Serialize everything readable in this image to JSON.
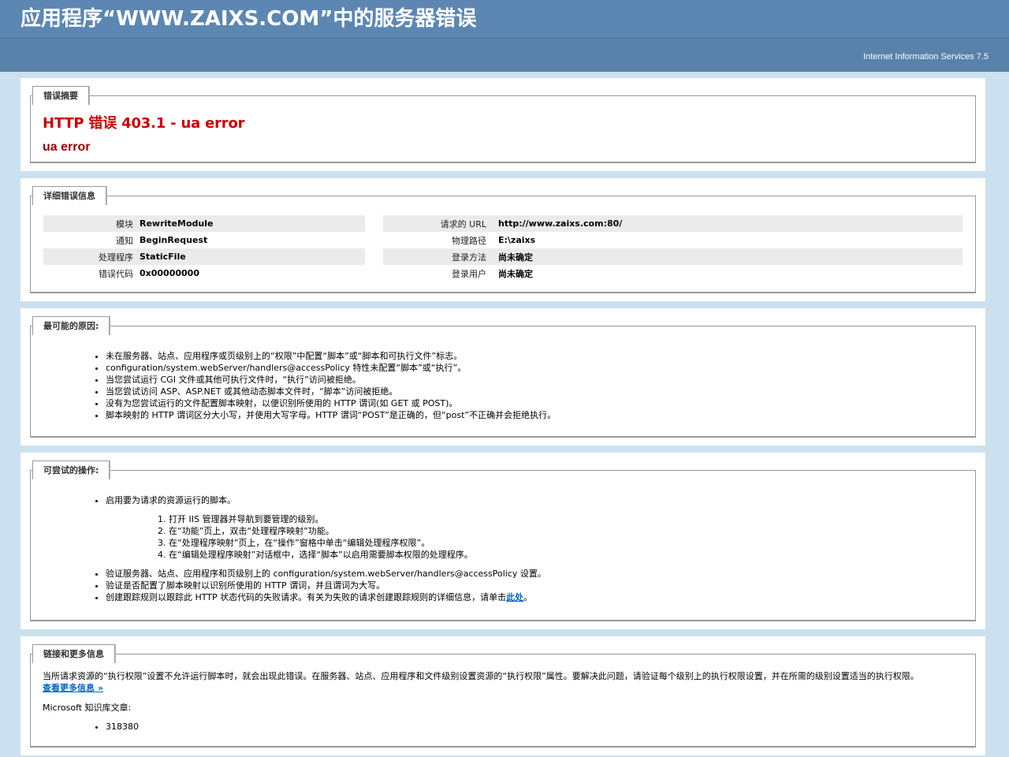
{
  "header": {
    "title": "应用程序“WWW.ZAIXS.COM”中的服务器错误",
    "server": "Internet Information Services 7.5"
  },
  "summary": {
    "legend": "错误摘要",
    "heading": "HTTP 错误 403.1 - ua error",
    "subheading": "ua error"
  },
  "details": {
    "legend": "详细错误信息",
    "left": [
      {
        "label": "模块",
        "value": "RewriteModule"
      },
      {
        "label": "通知",
        "value": "BeginRequest"
      },
      {
        "label": "处理程序",
        "value": "StaticFile"
      },
      {
        "label": "错误代码",
        "value": "0x00000000"
      }
    ],
    "right": [
      {
        "label": "请求的 URL",
        "value": "http://www.zaixs.com:80/"
      },
      {
        "label": "物理路径",
        "value": "E:\\zaixs"
      },
      {
        "label": "登录方法",
        "value": "尚未确定"
      },
      {
        "label": "登录用户",
        "value": "尚未确定"
      }
    ]
  },
  "causes": {
    "legend": "最可能的原因:",
    "items": [
      "未在服务器、站点、应用程序或页级别上的“权限”中配置“脚本”或“脚本和可执行文件”标志。",
      "configuration/system.webServer/handlers@accessPolicy 特性未配置“脚本”或“执行”。",
      "当您尝试运行 CGI 文件或其他可执行文件时，“执行”访问被拒绝。",
      "当您尝试访问 ASP、ASP.NET 或其他动态脚本文件时，“脚本”访问被拒绝。",
      "没有为您尝试运行的文件配置脚本映射，以便识别所使用的 HTTP 谓词(如 GET 或 POST)。",
      "脚本映射的 HTTP 谓词区分大小写，并使用大写字母。HTTP 谓词“POST”是正确的，但“post”不正确并会拒绝执行。"
    ]
  },
  "actions": {
    "legend": "可尝试的操作:",
    "first": "启用要为请求的资源运行的脚本。",
    "steps": [
      "打开 IIS 管理器并导航到要管理的级别。",
      "在“功能”页上，双击“处理程序映射”功能。",
      "在“处理程序映射”页上，在“操作”窗格中单击“编辑处理程序权限”。",
      "在“编辑处理程序映射”对话框中，选择“脚本”以启用需要脚本权限的处理程序。"
    ],
    "second": "验证服务器、站点、应用程序和页级别上的 configuration/system.webServer/handlers@accessPolicy 设置。",
    "third": "验证是否配置了脚本映射以识别所使用的 HTTP 谓词，并且谓词为大写。",
    "fourth_prefix": "创建跟踪规则以跟踪此 HTTP 状态代码的失败请求。有关为失败的请求创建跟踪规则的详细信息，请单击",
    "fourth_link": "此处",
    "fourth_suffix": "。"
  },
  "links": {
    "legend": "链接和更多信息",
    "description": "当所请求资源的“执行权限”设置不允许运行脚本时，就会出现此错误。在服务器、站点、应用程序和文件级别设置资源的“执行权限”属性。要解决此问题，请验证每个级别上的执行权限设置，并在所需的级别设置适当的执行权限。",
    "more": "查看更多信息 »",
    "kb_label": "Microsoft 知识库文章:",
    "kb_items": [
      "318380"
    ]
  }
}
